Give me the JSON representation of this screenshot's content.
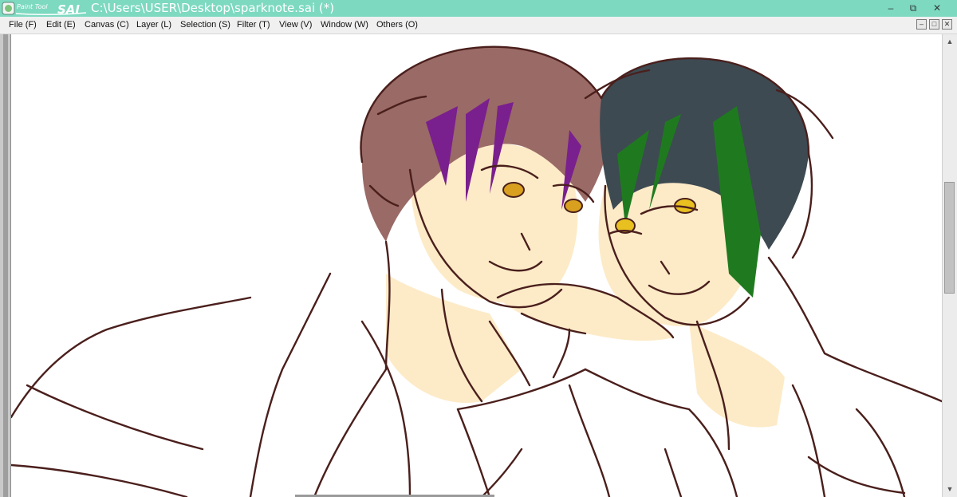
{
  "app": {
    "logo_small": "Paint Tool",
    "logo_large": "SAI",
    "title": "C:\\Users\\USER\\Desktop\\sparknote.sai (*)"
  },
  "window_controls": {
    "minimize": "–",
    "restore": "⧉",
    "close": "✕"
  },
  "menu": {
    "items": [
      {
        "label": "File (F)"
      },
      {
        "label": "Edit (E)"
      },
      {
        "label": "Canvas (C)"
      },
      {
        "label": "Layer (L)"
      },
      {
        "label": "Selection (S)"
      },
      {
        "label": "Filter (T)"
      },
      {
        "label": "View (V)"
      },
      {
        "label": "Window (W)"
      },
      {
        "label": "Others (O)"
      }
    ]
  },
  "mdi_controls": {
    "minimize": "–",
    "restore": "□",
    "close": "✕"
  },
  "scrollbar": {
    "up": "▲",
    "down": "▼"
  },
  "colors": {
    "titlebar": "#7dd9c0",
    "lineart": "#4a1f1c",
    "hair_left": "#9a6a66",
    "hair_left_streak": "#7a1f8e",
    "hair_right": "#3d4a52",
    "hair_right_streak": "#1f7a1f",
    "skin": "#fdebc8",
    "eyes": "#d9a020"
  }
}
